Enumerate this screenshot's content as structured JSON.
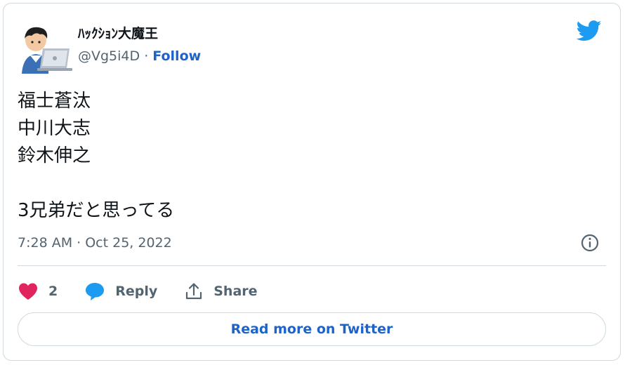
{
  "author": {
    "display_name": "ﾊｯｸｼｮﾝ大魔王",
    "handle": "@Vg5i4D",
    "separator": " · ",
    "follow_label": "Follow",
    "avatar_icon": "person-at-laptop-avatar-icon"
  },
  "tweet": {
    "text": "福士蒼汰\n中川大志\n鈴木伸之\n\n3兄弟だと思ってる",
    "timestamp": "7:28 AM · Oct 25, 2022"
  },
  "actions": {
    "like_count": "2",
    "reply_label": "Reply",
    "share_label": "Share"
  },
  "read_more_label": "Read more on Twitter",
  "colors": {
    "like": "#e0245e",
    "reply": "#1d9bf0",
    "link": "#1d63c9",
    "twitter_logo": "#1d9bf0",
    "border": "#cfd9de",
    "secondary_text": "#536471"
  },
  "icons": {
    "brand": "twitter-bird-icon",
    "info": "info-icon",
    "like": "heart-icon",
    "reply": "speech-bubble-icon",
    "share": "share-upload-icon"
  }
}
